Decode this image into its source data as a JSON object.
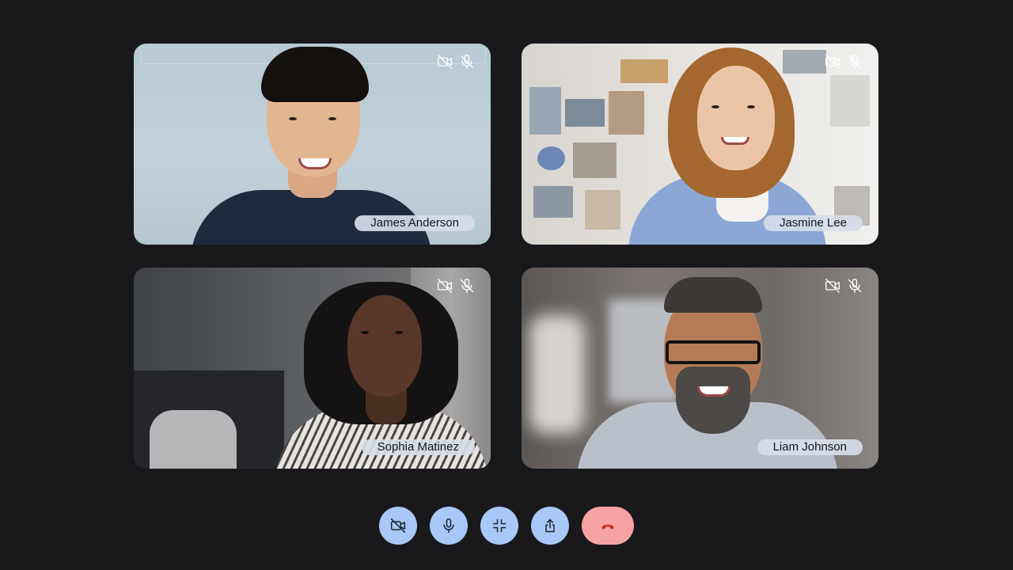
{
  "participants": [
    {
      "name": "James Anderson",
      "camera_icon": "camera-off-icon",
      "mic_icon": "mic-off-icon"
    },
    {
      "name": "Jasmine Lee",
      "camera_icon": "camera-off-icon",
      "mic_icon": "mic-off-icon"
    },
    {
      "name": "Sophia Matinez",
      "camera_icon": "camera-off-icon",
      "mic_icon": "mic-off-icon"
    },
    {
      "name": "Liam Johnson",
      "camera_icon": "camera-off-icon",
      "mic_icon": "mic-off-icon"
    }
  ],
  "controls": [
    {
      "name": "toggle-camera",
      "icon": "camera-off-icon"
    },
    {
      "name": "toggle-mic",
      "icon": "microphone-icon"
    },
    {
      "name": "minimize",
      "icon": "minimize-icon"
    },
    {
      "name": "share",
      "icon": "share-icon"
    },
    {
      "name": "end-call",
      "icon": "phone-hangup-icon"
    }
  ],
  "colors": {
    "background": "#19191c",
    "control_button": "#a8c8f8",
    "end_call_button": "#f8a3a3",
    "end_call_icon": "#d01c1c",
    "name_tag": "#d6dde8"
  }
}
